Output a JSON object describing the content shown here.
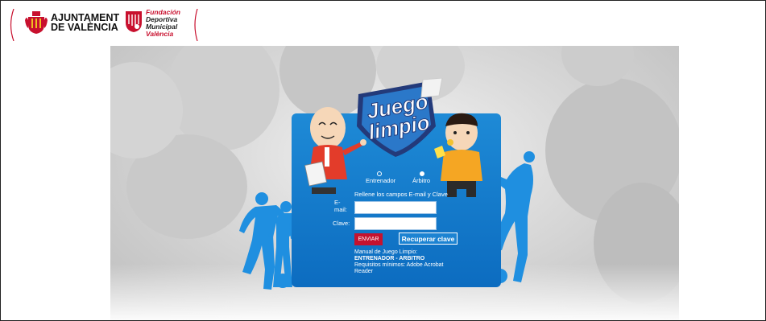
{
  "header": {
    "ajuntament_line1": "AJUNTAMENT",
    "ajuntament_line2": "DE VALÈNCIA",
    "fundacion_line1": "Fundación",
    "fundacion_line2": "Deportiva",
    "fundacion_line3": "Municipal",
    "fundacion_line4": "València"
  },
  "logo": {
    "line1": "Juego",
    "line2": "limpio"
  },
  "form": {
    "role_options": [
      {
        "label": "Entrenador",
        "selected": false
      },
      {
        "label": "Árbitro",
        "selected": true
      }
    ],
    "instructions": "Rellene los campos E-mail y Clave",
    "email_label_line1": "E-",
    "email_label_line2": "mail:",
    "email_value": "",
    "password_label": "Clave:",
    "password_value": "",
    "submit_label": "ENVIAR",
    "recover_label": "Recuperar clave"
  },
  "manual": {
    "intro": "Manual de Juego Limpio:",
    "link_entrenador": "ENTRENADOR",
    "separator": " - ",
    "link_arbitro": "ARBITRO",
    "requirements_line1": "Requisitos mínimos: Adobe Acrobat",
    "requirements_line2": "Reader"
  },
  "colors": {
    "card_blue": "#1780d2",
    "brand_red": "#c4122f",
    "badge_navy": "#233a7a",
    "badge_blue": "#2b78c9"
  }
}
